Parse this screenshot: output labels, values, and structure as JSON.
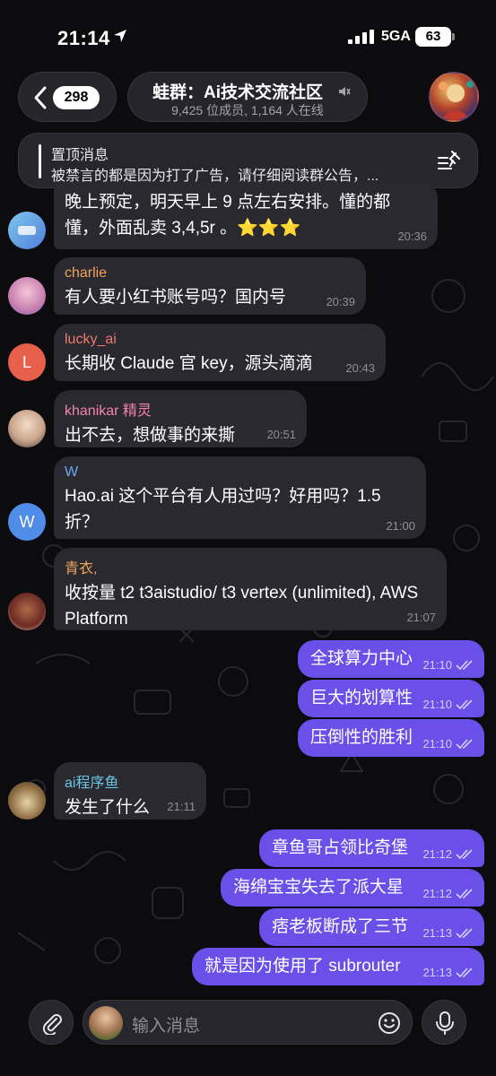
{
  "status_bar": {
    "time": "21:14",
    "network": "5GA",
    "battery": "63"
  },
  "header": {
    "back_count": "298",
    "title": "蛙群：Ai技术交流社区",
    "subtitle": "9,425 位成员, 1,164 人在线"
  },
  "pinned": {
    "title": "置顶消息",
    "text": "被禁言的都是因为打了广告，请仔细阅读群公告，..."
  },
  "messages": [
    {
      "sender": "",
      "text": "晚上预定，明天早上 9 点左右安排。懂的都懂，外面乱卖 3,4,5r 。⭐⭐⭐",
      "time": "20:36"
    },
    {
      "sender": "charlie",
      "text": "有人要小红书账号吗？国内号",
      "time": "20:39"
    },
    {
      "sender": "lucky_ai",
      "avatar_letter": "L",
      "text": "长期收 Claude 官 key，源头滴滴",
      "time": "20:43"
    },
    {
      "sender": "khanikar 精灵",
      "text": "出不去，想做事的来撕",
      "time": "20:51"
    },
    {
      "sender": "W",
      "avatar_letter": "W",
      "text": "Hao.ai 这个平台有人用过吗？好用吗？1.5 折？",
      "time": "21:00"
    },
    {
      "sender": "青衣,",
      "text": "收按量 t2 t3aistudio/ t3 vertex (unlimited), AWS Platform",
      "time": "21:07"
    },
    {
      "outgoing": true,
      "text": "全球算力中心",
      "time": "21:10"
    },
    {
      "outgoing": true,
      "text": "巨大的划算性",
      "time": "21:10"
    },
    {
      "outgoing": true,
      "text": "压倒性的胜利",
      "time": "21:10"
    },
    {
      "sender": "ai程序鱼",
      "text": "发生了什么",
      "time": "21:11"
    },
    {
      "outgoing": true,
      "text": "章鱼哥占领比奇堡",
      "time": "21:12"
    },
    {
      "outgoing": true,
      "text": "海绵宝宝失去了派大星",
      "time": "21:12"
    },
    {
      "outgoing": true,
      "text": "痞老板断成了三节",
      "time": "21:13"
    },
    {
      "outgoing": true,
      "text": "就是因为使用了 subrouter",
      "time": "21:13"
    }
  ],
  "input": {
    "placeholder": "输入消息"
  },
  "colors": {
    "background": "#0c0c0f",
    "incoming_bubble": "#2a292f",
    "outgoing_bubble": "#6a50e8",
    "sender_charlie": "#f0a35c",
    "sender_lucky_ai": "#f07a6a",
    "sender_khanikar": "#f285b0",
    "sender_w": "#6aaaf0",
    "sender_qingyi": "#f0a35c",
    "sender_ai_fish": "#6ac7e8"
  },
  "icons": [
    "location-arrow-icon",
    "signal-icon",
    "chevron-left-icon",
    "mute-icon",
    "pin-list-icon",
    "paperclip-icon",
    "emoji-icon",
    "microphone-icon",
    "double-check-icon"
  ]
}
